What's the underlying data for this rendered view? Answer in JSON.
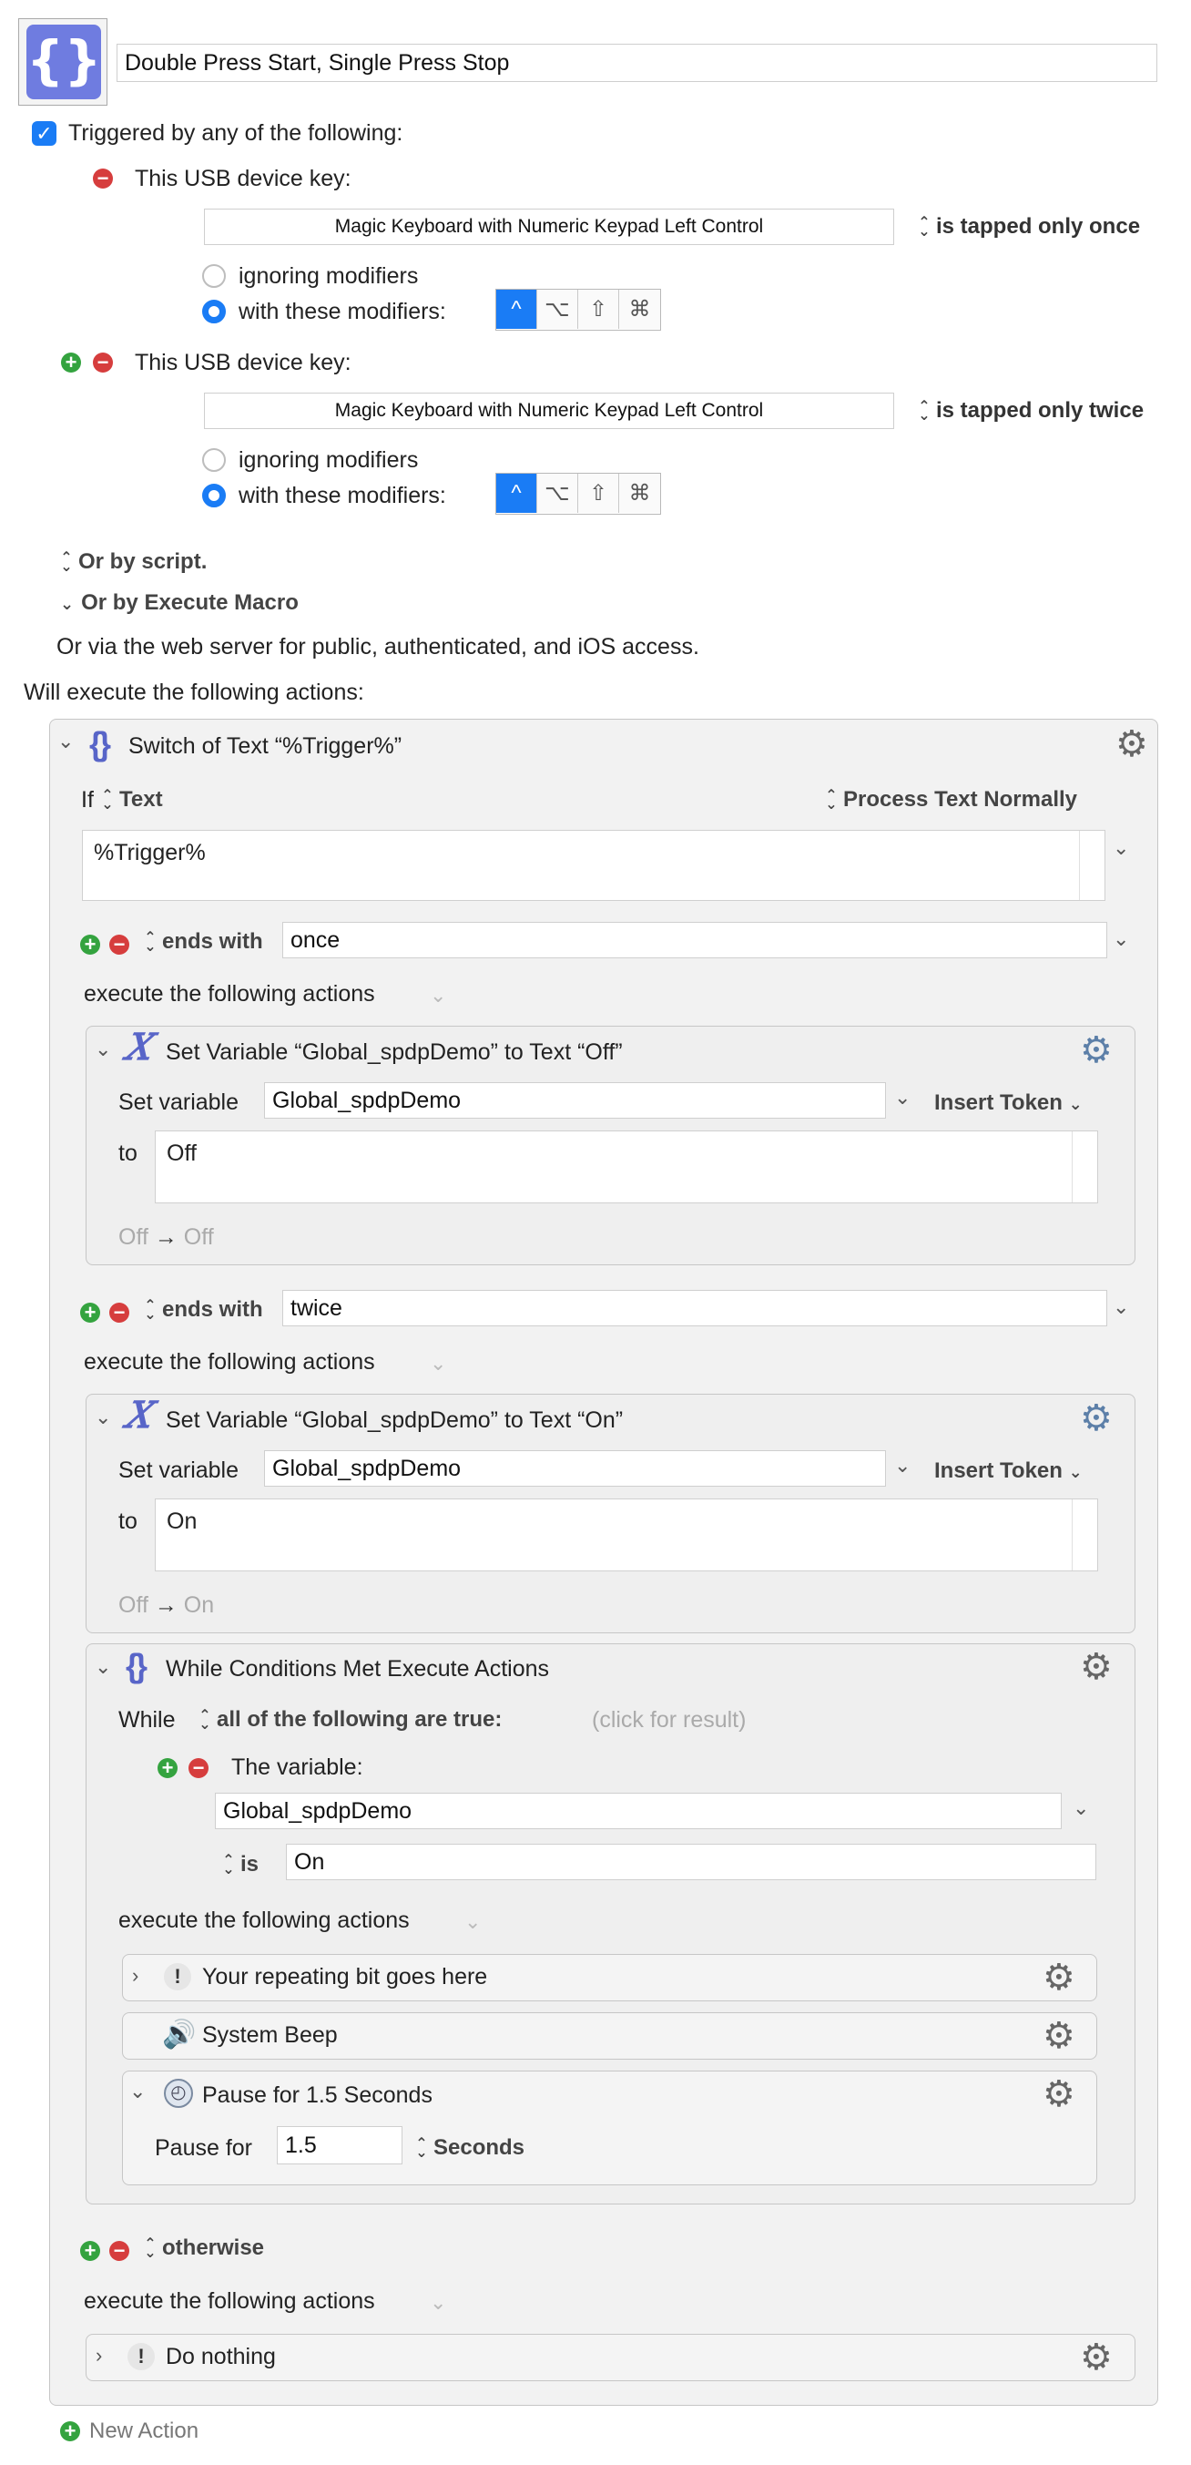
{
  "macro": {
    "title": "Double Press Start, Single Press Stop",
    "icon": "curly-braces-icon"
  },
  "triggers": {
    "header": "Triggered by any of the following:",
    "items": [
      {
        "label": "This USB device key:",
        "device": "Magic Keyboard with Numeric Keypad Left Control",
        "tap_mode": "is tapped only once",
        "opt_ignore": "ignoring modifiers",
        "opt_with": "with these modifiers:",
        "modifiers": [
          "^",
          "⌥",
          "⇧",
          "⌘"
        ]
      },
      {
        "label": "This USB device key:",
        "device": "Magic Keyboard with Numeric Keypad Left Control",
        "tap_mode": "is tapped only twice",
        "opt_ignore": "ignoring modifiers",
        "opt_with": "with these modifiers:",
        "modifiers": [
          "^",
          "⌥",
          "⇧",
          "⌘"
        ]
      }
    ],
    "or_script": "Or by script.",
    "or_execute": "Or by Execute Macro",
    "web_server": "Or via the web server for public, authenticated, and iOS access."
  },
  "actions_header": "Will execute the following actions:",
  "switch": {
    "title": "Switch of Text “%Trigger%”",
    "if_label": "If",
    "type": "Text",
    "process": "Process Text Normally",
    "text": "%Trigger%",
    "case1": {
      "op": "ends with",
      "value": "once",
      "exec": "execute the following actions",
      "action": {
        "title": "Set Variable “Global_spdpDemo” to Text “Off”",
        "set_label": "Set variable",
        "var": "Global_spdpDemo",
        "insert": "Insert Token",
        "to_label": "to",
        "value": "Off",
        "preview_from": "Off",
        "preview_to": "Off"
      }
    },
    "case2": {
      "op": "ends with",
      "value": "twice",
      "exec": "execute the following actions",
      "action": {
        "title": "Set Variable “Global_spdpDemo” to Text “On”",
        "set_label": "Set variable",
        "var": "Global_spdpDemo",
        "insert": "Insert Token",
        "to_label": "to",
        "value": "On",
        "preview_from": "Off",
        "preview_to": "On"
      },
      "while": {
        "title": "While Conditions Met Execute Actions",
        "while_label": "While",
        "cond": "all of the following are true:",
        "result": "(click for result)",
        "var_label": "The variable:",
        "var": "Global_spdpDemo",
        "is_label": "is",
        "is_value": "On",
        "exec": "execute the following actions",
        "rows": [
          {
            "title": "Your repeating bit goes here"
          },
          {
            "title": "System Beep"
          },
          {
            "title": "Pause for 1.5 Seconds"
          }
        ],
        "pause_label": "Pause for",
        "pause_value": "1.5",
        "pause_unit": "Seconds"
      }
    },
    "otherwise": {
      "label": "otherwise",
      "exec": "execute the following actions",
      "action": "Do nothing"
    }
  },
  "new_action": "New Action"
}
